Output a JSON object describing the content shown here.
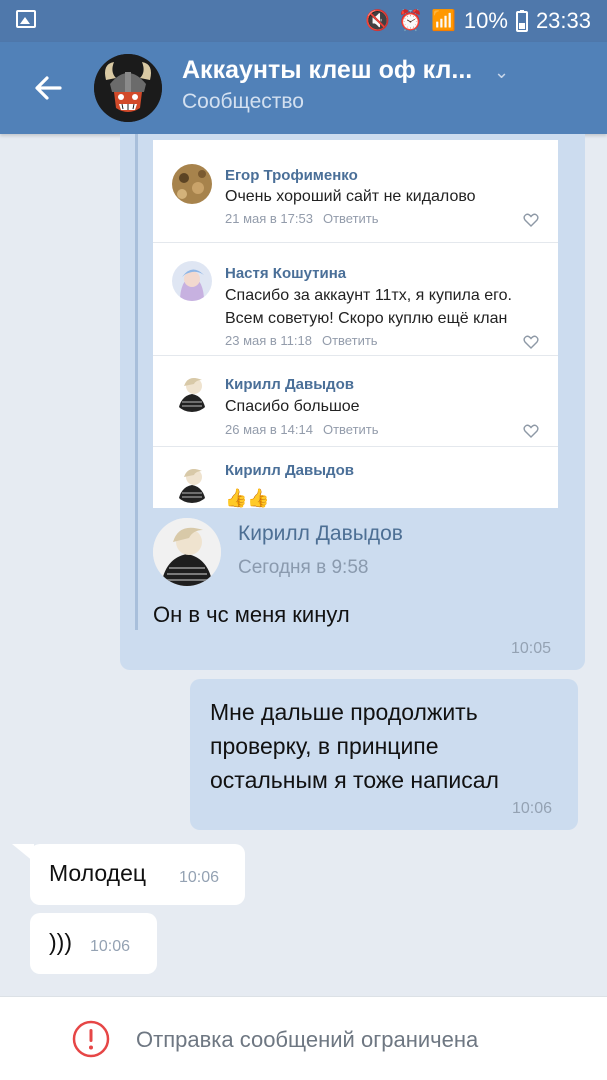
{
  "status_bar": {
    "battery_percent": "10%",
    "time": "23:33"
  },
  "header": {
    "title": "Аккаунты клеш оф кл...",
    "subtitle": "Сообщество"
  },
  "forwarded": {
    "comments": [
      {
        "name": "Егор Трофименко",
        "text": [
          "Очень хороший сайт не кидалово"
        ],
        "date": "21 мая в 17:53",
        "reply": "Ответить"
      },
      {
        "name": "Настя Кошутина",
        "text": [
          "Спасибо за аккаунт 11тх, я купила его.",
          "Всем советую! Скоро куплю ещё клан"
        ],
        "date": "23 мая в 11:18",
        "reply": "Ответить"
      },
      {
        "name": "Кирилл Давыдов",
        "text": [
          "Спасибо большое"
        ],
        "date": "26 мая в 14:14",
        "reply": "Ответить"
      },
      {
        "name": "Кирилл Давыдов",
        "text": [
          "👍👍"
        ]
      }
    ],
    "author": "Кирилл Давыдов",
    "date": "Сегодня в 9:58",
    "text": "Он в чс меня кинул",
    "time": "10:05"
  },
  "outgoing": {
    "lines": [
      "Мне дальше продолжить",
      "проверку, в принципе",
      "остальным я тоже написал"
    ],
    "time": "10:06"
  },
  "incoming": [
    {
      "text": "Молодец",
      "time": "10:06"
    },
    {
      "text": ")))",
      "time": "10:06"
    }
  ],
  "footer": {
    "text": "Отправка сообщений ограничена"
  },
  "colors": {
    "header": "#5181b8",
    "chat_bg": "#e6ebf2",
    "outgoing_bubble": "#ccdcef",
    "incoming_bubble": "#ffffff",
    "warning": "#e64646"
  }
}
